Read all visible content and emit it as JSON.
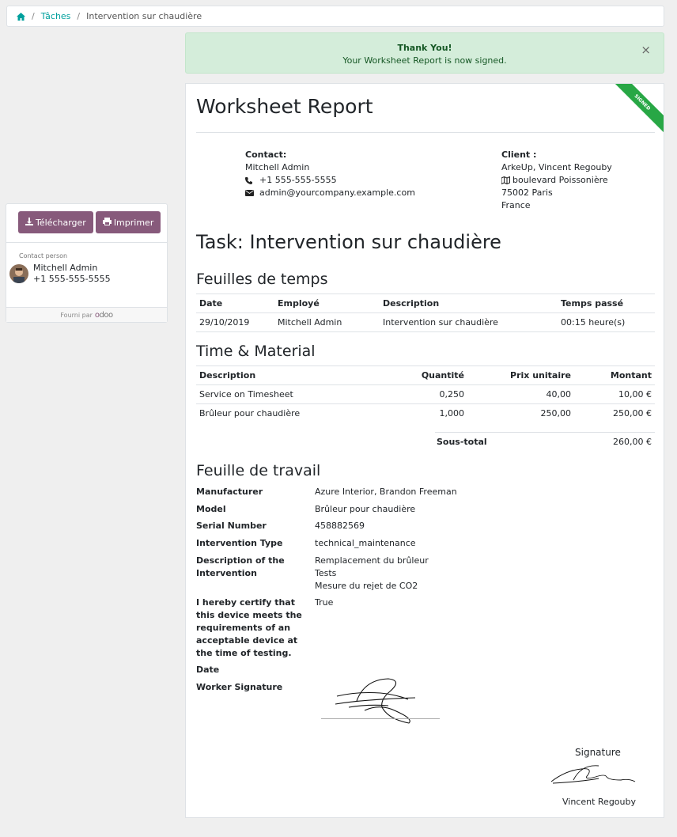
{
  "breadcrumb": {
    "tasks": "Tâches",
    "current": "Intervention sur chaudière"
  },
  "alert": {
    "title": "Thank You!",
    "message": "Your Worksheet Report is now signed.",
    "close": "×"
  },
  "sidebar": {
    "download_label": "Télécharger",
    "print_label": "Imprimer",
    "contact_label": "Contact person",
    "contact_name": "Mitchell Admin",
    "contact_phone": "+1 555-555-5555",
    "powered_by": "Fourni par",
    "logo": "odoo"
  },
  "report": {
    "ribbon": "SIGNED",
    "title": "Worksheet Report",
    "contact": {
      "label": "Contact:",
      "name": "Mitchell Admin",
      "phone": "+1 555-555-5555",
      "email": "admin@yourcompany.example.com"
    },
    "client": {
      "label": "Client :",
      "name": "ArkeUp, Vincent Regouby",
      "street": "boulevard Poissonière",
      "city": "75002 Paris",
      "country": "France"
    },
    "task_title": "Task: Intervention sur chaudière",
    "timesheets": {
      "title": "Feuilles de temps",
      "headers": [
        "Date",
        "Employé",
        "Description",
        "Temps passé"
      ],
      "rows": [
        [
          "29/10/2019",
          "Mitchell Admin",
          "Intervention sur chaudière",
          "00:15 heure(s)"
        ]
      ]
    },
    "material": {
      "title": "Time & Material",
      "headers": [
        "Description",
        "Quantité",
        "Prix unitaire",
        "Montant"
      ],
      "rows": [
        [
          "Service on Timesheet",
          "0,250",
          "40,00",
          "10,00 €"
        ],
        [
          "Brûleur pour chaudière",
          "1,000",
          "250,00",
          "250,00 €"
        ]
      ],
      "subtotal_label": "Sous-total",
      "subtotal_value": "260,00 €"
    },
    "worksheet": {
      "title": "Feuille de travail",
      "manufacturer_label": "Manufacturer",
      "manufacturer": "Azure Interior, Brandon Freeman",
      "model_label": "Model",
      "model": "Brûleur pour chaudière",
      "serial_label": "Serial Number",
      "serial": "458882569",
      "type_label": "Intervention Type",
      "type": "technical_maintenance",
      "desc_label": "Description of the Intervention",
      "desc_line1": "Remplacement du brûleur",
      "desc_line2": "Tests",
      "desc_line3": "Mesure du rejet de CO2",
      "certify_label": "I hereby certify that this device meets the requirements of an acceptable device at the time of testing.",
      "certify": "True",
      "date_label": "Date",
      "worker_sig_label": "Worker Signature"
    },
    "signature_label": "Signature",
    "signer_name": "Vincent Regouby"
  },
  "colors": {
    "accent": "#875a7b",
    "link": "#00a09d",
    "success_bg": "#d4edda",
    "ribbon": "#28a745"
  }
}
